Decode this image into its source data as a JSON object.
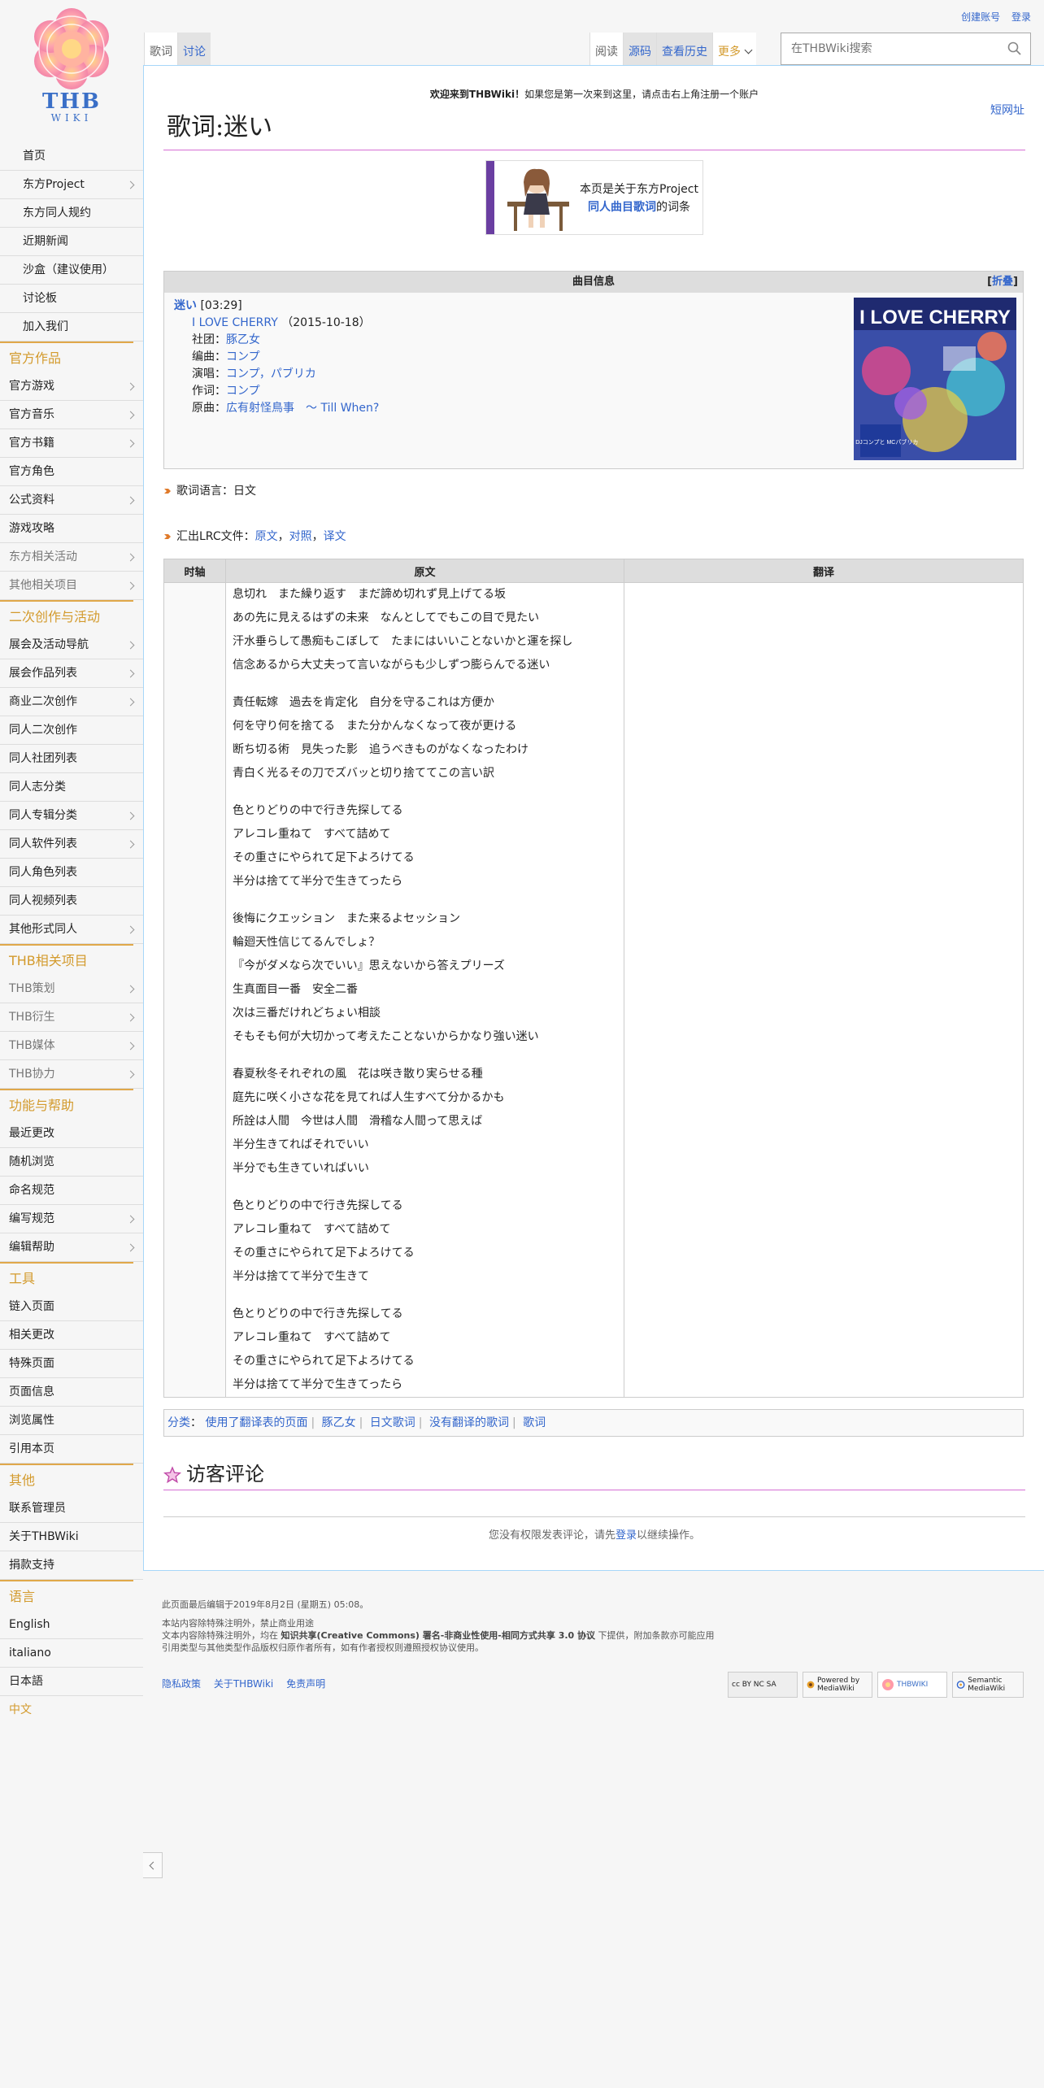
{
  "personal": {
    "create_account": "创建账号",
    "login": "登录"
  },
  "logo": {
    "title": "THB",
    "subtitle": "WIKI"
  },
  "tabs_left": [
    "歌词",
    "讨论"
  ],
  "tabs_right": [
    "阅读",
    "源码",
    "查看历史"
  ],
  "more_label": "更多",
  "search": {
    "placeholder": "在THBWiki搜索"
  },
  "nav": {
    "top": [
      "首页",
      "东方Project",
      "东方同人规约",
      "近期新闻",
      "沙盒（建议使用）",
      "讨论板",
      "加入我们"
    ],
    "sections": [
      {
        "heading": "官方作品",
        "items": [
          "官方游戏",
          "官方音乐",
          "官方书籍",
          "官方角色",
          "公式资料",
          "游戏攻略",
          "东方相关活动",
          "其他相关项目"
        ]
      },
      {
        "heading": "二次创作与活动",
        "items": [
          "展会及活动导航",
          "展会作品列表",
          "商业二次创作",
          "同人二次创作",
          "同人社团列表",
          "同人志分类",
          "同人专辑分类",
          "同人软件列表",
          "同人角色列表",
          "同人视频列表",
          "其他形式同人"
        ]
      },
      {
        "heading": "THB相关项目",
        "items": [
          "THB策划",
          "THB衍生",
          "THB媒体",
          "THB协力"
        ]
      },
      {
        "heading": "功能与帮助",
        "items": [
          "最近更改",
          "随机浏览",
          "命名规范",
          "编写规范",
          "编辑帮助"
        ]
      },
      {
        "heading": "工具",
        "items": [
          "链入页面",
          "相关更改",
          "特殊页面",
          "页面信息",
          "浏览属性",
          "引用本页"
        ]
      },
      {
        "heading": "其他",
        "items": [
          "联系管理员",
          "关于THBWiki",
          "捐款支持"
        ]
      },
      {
        "heading": "语言",
        "items": [
          "English",
          "italiano",
          "日本語",
          "中文"
        ]
      }
    ]
  },
  "notice": {
    "bold": "欢迎来到THBWiki！",
    "text": "如果您是第一次来到这里，请点击右上角注册一个账户"
  },
  "shorturl": "短网址",
  "page_title": "歌词:迷い",
  "project_box": {
    "line1": "本页是关于东方Project",
    "link": "同人曲目歌词",
    "suffix": "的词条"
  },
  "song_info": {
    "header": "曲目信息",
    "fold": "折叠",
    "song": "迷い",
    "duration": "[03:29]",
    "album": "I LOVE CHERRY",
    "album_date": "（2015-10-18）",
    "circle_label": "社团：",
    "circle": "豚乙女",
    "arrange_label": "编曲：",
    "arrange": "コンプ",
    "vocal_label": "演唱：",
    "vocal": "コンプ，パブリカ",
    "lyricist_label": "作词：",
    "lyricist": "コンプ",
    "original_label": "原曲：",
    "original_game": "広有射怪鳥事",
    "original_tune": "～ Till When?",
    "cover_title": "I LOVE CHERRY",
    "cover_sub": "feat. DJコンプと MCパブリカ"
  },
  "lyrics_language": "歌词语言：日文",
  "lrc": {
    "label": "汇出LRC文件：",
    "links": [
      "原文",
      "对照",
      "译文"
    ]
  },
  "lyrics_table": {
    "headers": [
      "时轴",
      "原文",
      "翻译"
    ],
    "stanzas": [
      [
        "息切れ　また繰り返す　まだ諦め切れず見上げてる坂",
        "あの先に見えるはずの未来　なんとしてでもこの目で見たい",
        "汗水垂らして愚痴もこぼして　たまにはいいことないかと運を探し",
        "信念あるから大丈夫って言いながらも少しずつ膨らんでる迷い"
      ],
      [
        "責任転嫁　過去を肯定化　自分を守るこれは方便か",
        "何を守り何を捨てる　また分かんなくなって夜が更ける",
        "断ち切る術　見失った影　追うべきものがなくなったわけ",
        "青白く光るその刀でズバッと切り捨ててこの言い訳"
      ],
      [
        "色とりどりの中で行き先探してる",
        "アレコレ重ねて　すべて詰めて",
        "その重さにやられて足下よろけてる",
        "半分は捨てて半分で生きてったら"
      ],
      [
        "後悔にクエッション　また来るよセッション",
        "輪廻天性信じてるんでしょ？",
        "『今がダメなら次でいい』思えないから答えプリーズ",
        "生真面目一番　安全二番",
        "次は三番だけれどちょい相談",
        "そもそも何が大切かって考えたことないからかなり強い迷い"
      ],
      [
        "春夏秋冬それぞれの風　花は咲き散り実らせる種",
        "庭先に咲く小さな花を見てれば人生すべて分かるかも",
        "所詮は人間　今世は人間　滑稽な人間って思えば",
        "半分生きてればそれでいい",
        "半分でも生きていればいい"
      ],
      [
        "色とりどりの中で行き先探してる",
        "アレコレ重ねて　すべて詰めて",
        "その重さにやられて足下よろけてる",
        "半分は捨てて半分で生きて"
      ],
      [
        "色とりどりの中で行き先探してる",
        "アレコレ重ねて　すべて詰めて",
        "その重さにやられて足下よろけてる",
        "半分は捨てて半分で生きてったら"
      ]
    ]
  },
  "categories": {
    "label": "分类",
    "items": [
      "使用了翻译表的页面",
      "豚乙女",
      "日文歌词",
      "没有翻译的歌词",
      "歌词"
    ]
  },
  "comments": {
    "title": "访客评论",
    "note_before": "您没有权限发表评论，请先",
    "note_link": "登录",
    "note_after": "以继续操作。"
  },
  "footer": {
    "last_edit": "此页面最后编辑于2019年8月2日 (星期五) 05:08。",
    "license1": "本站内容除特殊注明外，禁止商业用途",
    "license2_a": "文本内容除特殊注明外，均在 ",
    "license2_b": "知识共享(Creative Commons) 署名-非商业性使用-相同方式共享 3.0 协议",
    "license2_c": " 下提供，附加条款亦可能应用",
    "license3": "引用类型与其他类型作品版权归原作者所有，如有作者授权则遵照授权协议使用。",
    "links": [
      "隐私政策",
      "关于THBWiki",
      "免责声明"
    ],
    "badges": [
      "cc BY NC SA",
      "Powered by MediaWiki",
      "THBWIKI",
      "Semantic MediaWiki"
    ]
  },
  "colors": {
    "accent_orange": "#d39a2c",
    "link": "#3366cc",
    "title_rule": "#d66fd4",
    "project_bar": "#6a3ea1"
  }
}
